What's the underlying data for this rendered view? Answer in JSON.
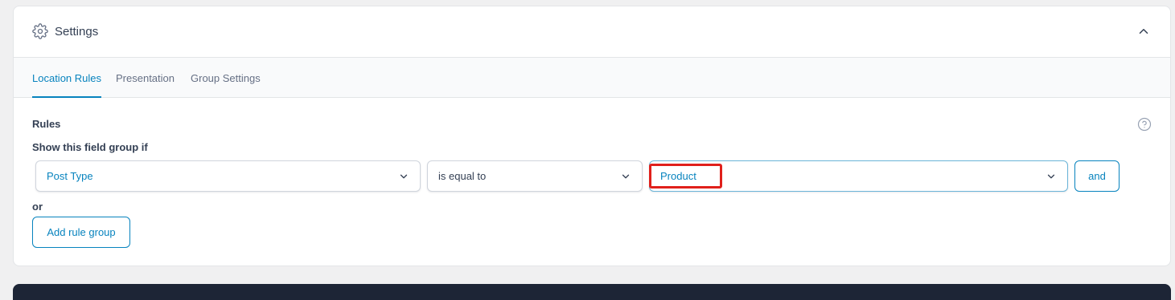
{
  "header": {
    "title": "Settings"
  },
  "tabs": [
    {
      "label": "Location Rules",
      "active": true
    },
    {
      "label": "Presentation",
      "active": false
    },
    {
      "label": "Group Settings",
      "active": false
    }
  ],
  "rules": {
    "label": "Rules",
    "show_if_label": "Show this field group if",
    "param": "Post Type",
    "operator": "is equal to",
    "value": "Product",
    "and_label": "and",
    "or_label": "or",
    "add_group_label": "Add rule group"
  },
  "colors": {
    "accent": "#0783be",
    "highlight": "#e0201b"
  },
  "icons": {
    "settings": "gear-icon",
    "collapse": "chevron-up-icon",
    "help": "help-icon",
    "dropdown": "chevron-down-icon"
  }
}
